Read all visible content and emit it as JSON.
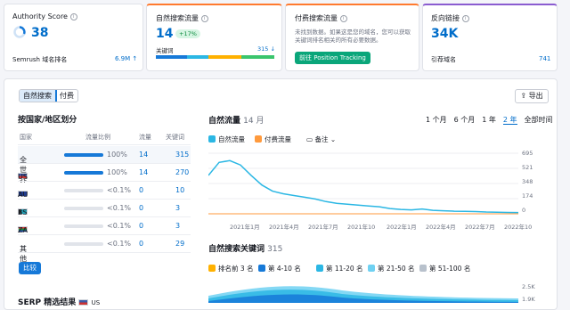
{
  "authority": {
    "title": "Authority Score",
    "score": "38",
    "semrush_label": "Semrush 域名排名",
    "semrush_value": "6.9M ↑"
  },
  "organic": {
    "title": "自然搜索流量",
    "value": "14",
    "badge": "+17%",
    "kw_label": "关键词",
    "kw_value": "315 ↓",
    "bar_colors": [
      "#ffb100",
      "#2bb7e4",
      "#3ac56d",
      "#1679d8"
    ]
  },
  "paid": {
    "title": "付费搜索流量",
    "desc": "未找到数据。如果这是您的域名，您可以获取关键词排名相关的所有必要数据。",
    "button": "前往 Position Tracking"
  },
  "backlinks": {
    "title": "反向链接",
    "value": "34K",
    "ref_label": "引荐域名",
    "ref_value": "741"
  },
  "tabs": {
    "organic": "自然搜索",
    "paid": "付费"
  },
  "export": "导出",
  "country": {
    "title": "按国家/地区划分",
    "headers": [
      "国家",
      "流量比例",
      "流量",
      "关键词"
    ],
    "rows": [
      {
        "name": "全世界",
        "pct": "100%",
        "traffic": "14",
        "kw": "315",
        "bar": 1.0
      },
      {
        "name": "US",
        "pct": "100%",
        "traffic": "14",
        "kw": "270",
        "bar": 1.0
      },
      {
        "name": "AU",
        "pct": "<0.1%",
        "traffic": "0",
        "kw": "10",
        "bar": 0
      },
      {
        "name": "BS",
        "pct": "<0.1%",
        "traffic": "0",
        "kw": "3",
        "bar": 0
      },
      {
        "name": "ZA",
        "pct": "<0.1%",
        "traffic": "0",
        "kw": "3",
        "bar": 0
      },
      {
        "name": "其他",
        "pct": "<0.1%",
        "traffic": "0",
        "kw": "29",
        "bar": 0
      }
    ],
    "compare": "比较"
  },
  "serp": {
    "title": "SERP 精选结果",
    "country": "US"
  },
  "traffic_chart": {
    "title": "自然流量",
    "period": "14 月",
    "ranges": [
      "1 个月",
      "6 个月",
      "1 年",
      "2 年",
      "全部时间"
    ],
    "active_range": "2 年",
    "legend": [
      "自然流量",
      "付费流量"
    ],
    "notes": "备注",
    "chart_data": {
      "type": "line",
      "x": [
        "2021年1月",
        "2021年4月",
        "2021年7月",
        "2021年10",
        "2022年1月",
        "2022年4月",
        "2022年7月",
        "2022年10"
      ],
      "y_ticks": [
        "695",
        "521",
        "348",
        "174",
        "0"
      ],
      "series": [
        {
          "name": "自然流量",
          "values": [
            440,
            590,
            610,
            560,
            440,
            330,
            260,
            230,
            210,
            190,
            170,
            140,
            120,
            110,
            100,
            90,
            80,
            60,
            50,
            45,
            55,
            40,
            35,
            30,
            28,
            25,
            20,
            18,
            15,
            14
          ]
        },
        {
          "name": "付费流量",
          "values": [
            0,
            0,
            0,
            0,
            0,
            0,
            0,
            0,
            0,
            0,
            0,
            0,
            0,
            0,
            0,
            0,
            0,
            0,
            0,
            0,
            0,
            0,
            0,
            0,
            0,
            0,
            0,
            0,
            0,
            0
          ]
        }
      ],
      "ylim": [
        0,
        695
      ]
    }
  },
  "kw_chart": {
    "title": "自然搜索关键词",
    "count": "315",
    "legend": [
      "排名前 3 名",
      "第 4-10 名",
      "第 11-20 名",
      "第 21-50 名",
      "第 51-100 名"
    ],
    "legend_colors": [
      "#ffb100",
      "#1679d8",
      "#2bb7e4",
      "#6fd1f2",
      "#b8c1cc"
    ],
    "y_ticks": [
      "2.5K",
      "1.9K"
    ]
  }
}
